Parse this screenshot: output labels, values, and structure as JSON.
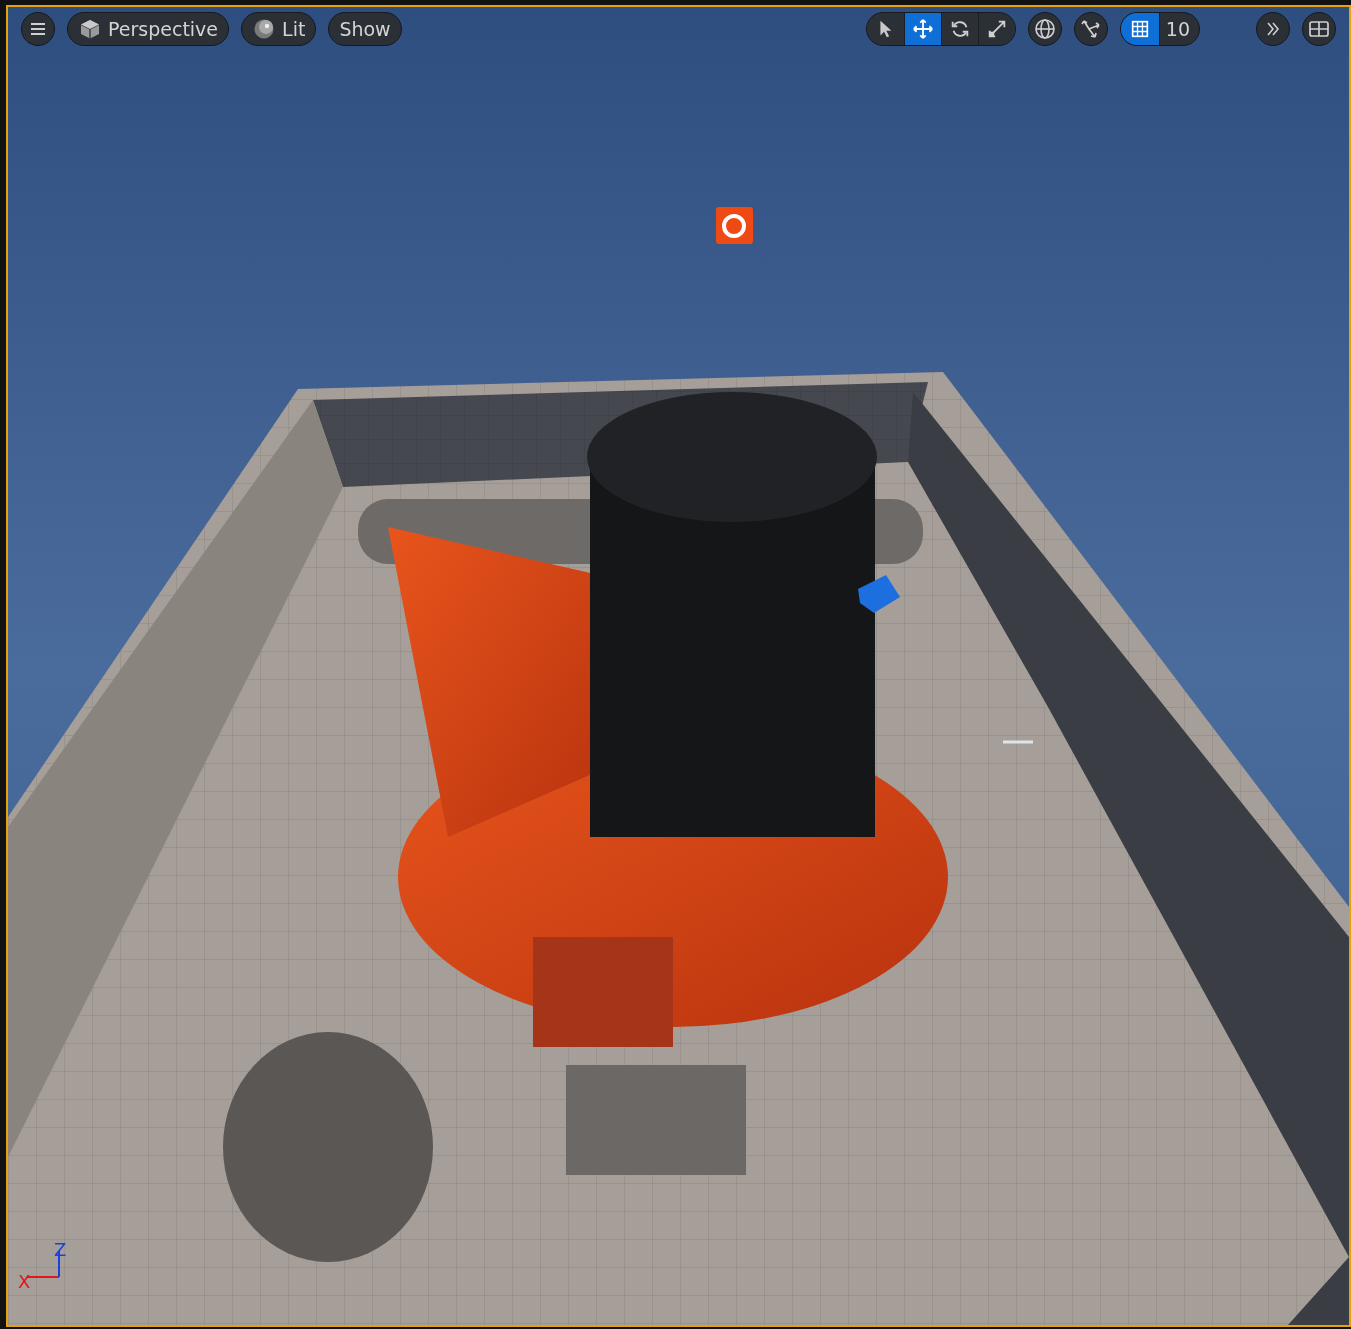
{
  "toolbar": {
    "view_buttons": [
      {
        "label": "Perspective"
      },
      {
        "label": "Lit"
      },
      {
        "label": "Show"
      }
    ],
    "transform_tools": [
      {
        "selected": false
      },
      {
        "selected": true
      },
      {
        "selected": false
      },
      {
        "selected": false
      }
    ],
    "grid_snap": {
      "on": true,
      "value": "10"
    }
  },
  "axis_gizmo": {
    "x_label": "X",
    "z_label": "Z"
  }
}
